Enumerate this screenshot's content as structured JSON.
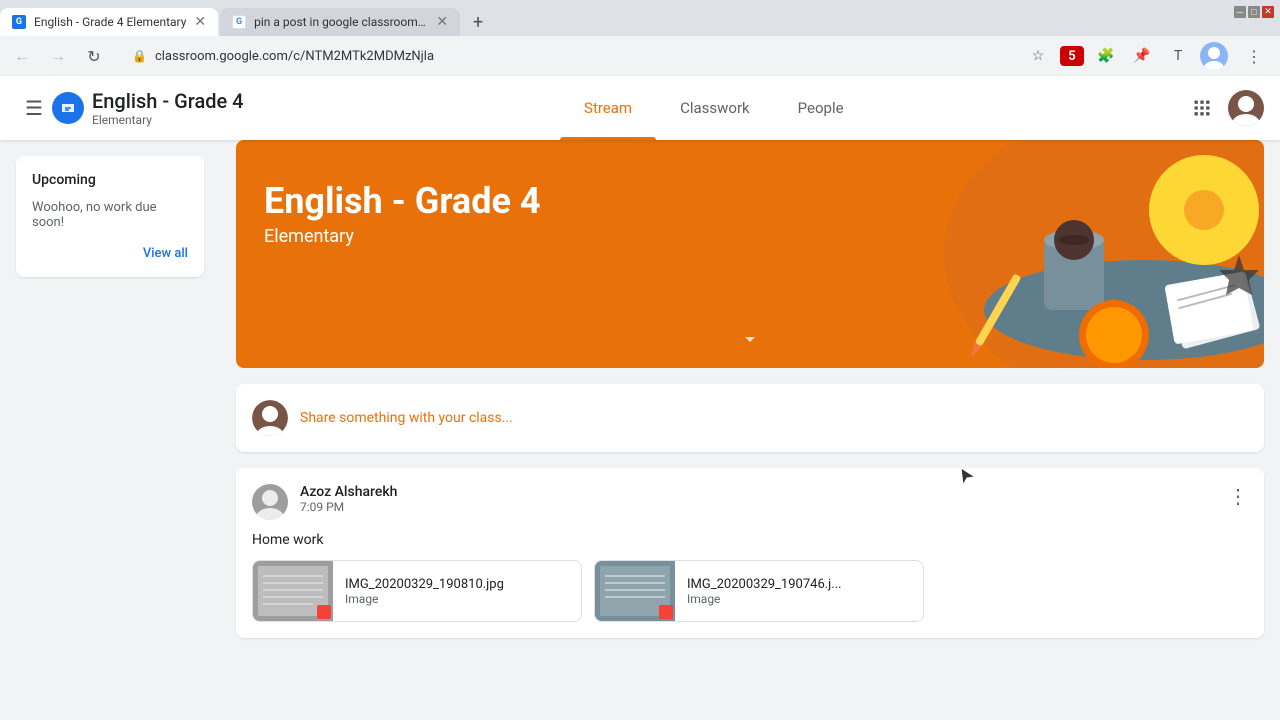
{
  "browser": {
    "tabs": [
      {
        "id": "tab1",
        "favicon_type": "classroom",
        "title": "English - Grade 4 Elementary",
        "active": true
      },
      {
        "id": "tab2",
        "favicon_type": "google",
        "title": "pin a post in google classroom s...",
        "active": false
      }
    ],
    "address": "classroom.google.com/c/NTM2MTk2MDMzNjla",
    "new_tab_icon": "+"
  },
  "header": {
    "class_title": "English - Grade 4",
    "class_subtitle": "Elementary",
    "nav_tabs": [
      {
        "id": "stream",
        "label": "Stream",
        "active": true
      },
      {
        "id": "classwork",
        "label": "Classwork",
        "active": false
      },
      {
        "id": "people",
        "label": "People",
        "active": false
      }
    ]
  },
  "banner": {
    "class_title": "English - Grade 4",
    "class_subtitle": "Elementary",
    "chevron": "∨"
  },
  "sidebar": {
    "upcoming_title": "Upcoming",
    "upcoming_empty_text": "Woohoo, no work due soon!",
    "view_all_label": "View all"
  },
  "stream": {
    "share_placeholder": "Share something with your class...",
    "posts": [
      {
        "id": "post1",
        "author": "Azoz Alsharekh",
        "time": "7:09 PM",
        "content": "Home work",
        "attachments": [
          {
            "id": "att1",
            "name": "IMG_20200329_190810.jpg",
            "type": "Image",
            "thumb_color": "#9e9e9e"
          },
          {
            "id": "att2",
            "name": "IMG_20200329_190746.j...",
            "type": "Image",
            "thumb_color": "#78909c"
          }
        ]
      }
    ]
  }
}
